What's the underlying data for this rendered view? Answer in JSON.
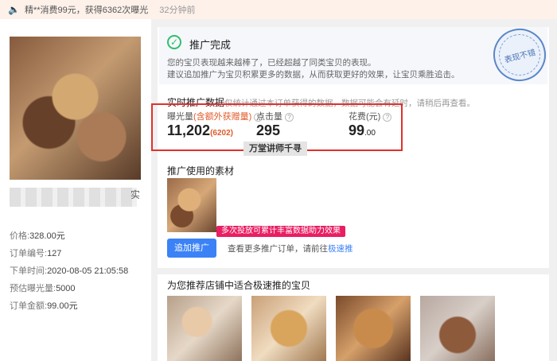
{
  "topbar": {
    "message": "精**消费99元，获得6362次曝光",
    "ago": "32分钟前"
  },
  "product": {
    "title_tail": "实",
    "info": [
      {
        "label": "价格:",
        "value": "328.00元"
      },
      {
        "label": "订单编号:",
        "value": "127"
      },
      {
        "label": "下单时间:",
        "value": "2020-08-05 21:05:58"
      },
      {
        "label": "预估曝光量:",
        "value": "5000"
      },
      {
        "label": "订单金额:",
        "value": "99.00元"
      }
    ]
  },
  "done": {
    "title": "推广完成",
    "desc1": "您的宝贝表现越来越棒了，已经超越了同类宝贝的表现。",
    "desc2": "建议追加推广为宝贝积累更多的数据，从而获取更好的效果，让宝贝乘胜追击。",
    "stamp": "表现不错"
  },
  "stats": {
    "title": "实时推广数据",
    "hint": "仅统计通过本订单获得的数据，数据可能会有延时，请稍后再查看。",
    "exposure_label": "曝光量",
    "exposure_note": "(含额外获赠量)",
    "exposure_value": "11,202",
    "exposure_extra": "(6202)",
    "click_label": "点击量",
    "click_value": "295",
    "cost_label": "花费(元)",
    "cost_int": "99",
    "cost_dec": ".00",
    "overlay": "万堂讲师千寻"
  },
  "material": {
    "title": "推广使用的素材",
    "tip": "多次投放可累计丰富数据助力效果",
    "add_button": "追加推广",
    "more_text": "查看更多推广订单，请前往",
    "more_link": "极速推"
  },
  "recommend": {
    "title": "为您推荐店铺中适合极速推的宝贝"
  }
}
